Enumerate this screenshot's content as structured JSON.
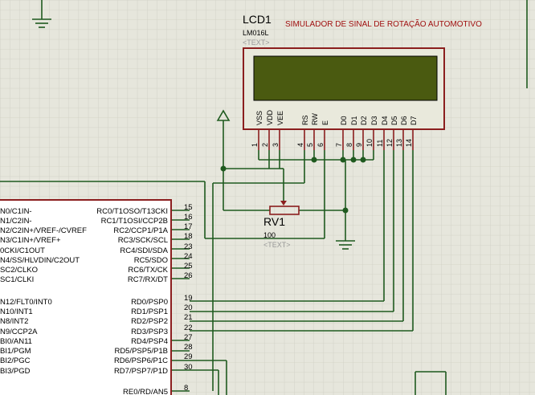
{
  "colors": {
    "background": "#e6e6dc",
    "grid": "#cfcfc4",
    "wire": "#1f5a1f",
    "component": "#8b1e1e",
    "body_fill": "#ffffff",
    "lcd_screen": "#4a5a10",
    "lcd_body": "#e9e9dc",
    "pin_text": "#000000",
    "title_text": "#a01010",
    "placeholder_text": "#9a9a9a",
    "junction": "#1f5a1f"
  },
  "lcd": {
    "ref": "LCD1",
    "model": "LM016L",
    "placeholder": "<TEXT>",
    "pin_names": [
      "VSS",
      "VDD",
      "VEE",
      "RS",
      "RW",
      "E",
      "D0",
      "D1",
      "D2",
      "D3",
      "D4",
      "D5",
      "D6",
      "D7"
    ],
    "pin_numbers": [
      "1",
      "2",
      "3",
      "4",
      "5",
      "6",
      "7",
      "8",
      "9",
      "10",
      "11",
      "12",
      "13",
      "14"
    ]
  },
  "title": "SIMULADOR DE SINAL DE ROTAÇÃO AUTOMOTIVO",
  "pot": {
    "ref": "RV1",
    "value": "100",
    "placeholder": "<TEXT>"
  },
  "mcu": {
    "left_pins": [
      "N0/C1IN-",
      "N1/C2IN-",
      "N2/C2IN+/VREF-/CVREF",
      "N3/C1IN+/VREF+",
      "0CKI/C1OUT",
      "N4/SS/HLVDIN/C2OUT",
      "SC2/CLKO",
      "SC1/CLKI",
      "N12/FLT0/INT0",
      "N10/INT1",
      "N8/INT2",
      "N9/CCP2A",
      "BI0/AN11",
      "BI1/PGM",
      "BI2/PGC",
      "BI3/PGD"
    ],
    "right_pins": [
      "RC0/T1OSO/T13CKI",
      "RC1/T1OSI/CCP2B",
      "RC2/CCP1/P1A",
      "RC3/SCK/SCL",
      "RC4/SDI/SDA",
      "RC5/SDO",
      "RC6/TX/CK",
      "RC7/RX/DT",
      "RD0/PSP0",
      "RD1/PSP1",
      "RD2/PSP2",
      "RD3/PSP3",
      "RD4/PSP4",
      "RD5/PSP5/P1B",
      "RD6/PSP6/P1C",
      "RD7/PSP7/P1D",
      "RE0/RD/AN5"
    ],
    "right_pin_numbers": [
      "15",
      "16",
      "17",
      "18",
      "23",
      "24",
      "25",
      "26",
      "19",
      "20",
      "21",
      "22",
      "27",
      "28",
      "29",
      "30",
      "8"
    ]
  }
}
